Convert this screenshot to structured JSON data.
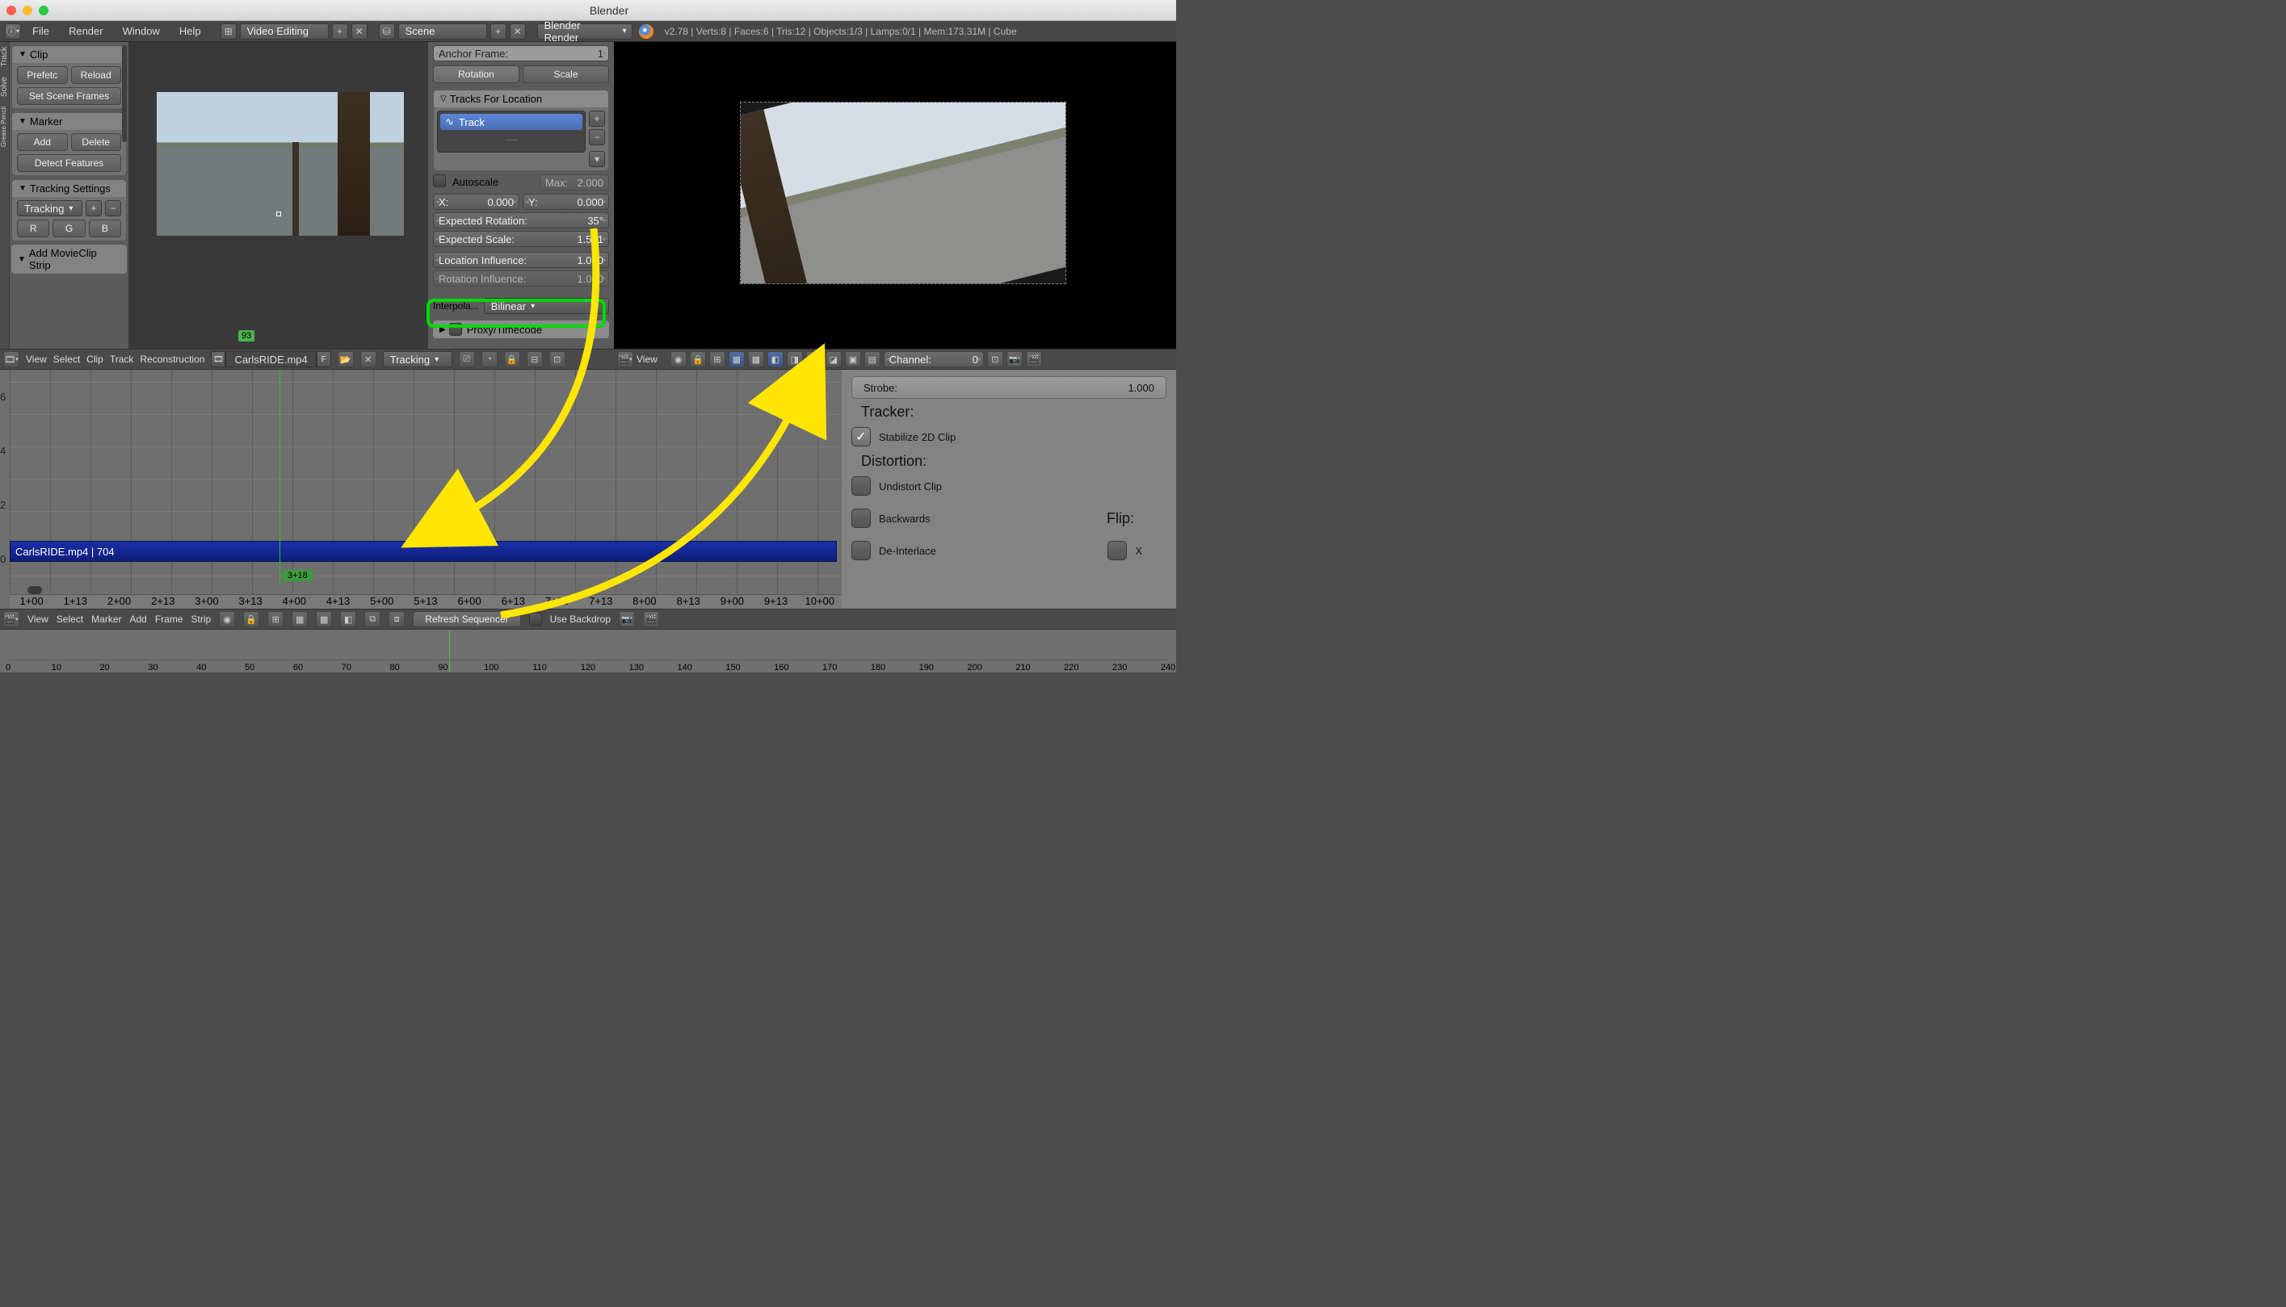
{
  "window": {
    "title": "Blender"
  },
  "topbar": {
    "menus": [
      "File",
      "Render",
      "Window",
      "Help"
    ],
    "screen_layout": "Video Editing",
    "scene": "Scene",
    "engine": "Blender Render",
    "stats": "v2.78 | Verts:8 | Faces:6 | Tris:12 | Objects:1/3 | Lamps:0/1 | Mem:173.31M | Cube"
  },
  "tool_tabs": [
    "Track",
    "Solve",
    "Grease Pencil"
  ],
  "tool_shelf": {
    "clip": {
      "title": "Clip",
      "prefetch": "Prefetc",
      "reload": "Reload",
      "set_scene_frames": "Set Scene Frames"
    },
    "marker": {
      "title": "Marker",
      "add": "Add",
      "delete": "Delete",
      "detect": "Detect Features"
    },
    "tracking_settings": {
      "title": "Tracking Settings",
      "preset": "Tracking",
      "channels": [
        "R",
        "G",
        "B"
      ]
    },
    "add_strip_title": "Add MovieClip Strip"
  },
  "props": {
    "anchor_frame_label": "Anchor Frame:",
    "anchor_frame_value": "1",
    "rotation_tab": "Rotation",
    "scale_tab": "Scale",
    "tracks_for_location": "Tracks For Location",
    "track_item": "Track",
    "autoscale_label": "Autoscale",
    "autoscale_max_label": "Max:",
    "autoscale_max_value": "2.000",
    "x_label": "X:",
    "x_value": "0.000",
    "y_label": "Y:",
    "y_value": "0.000",
    "exp_rot_label": "Expected Rotation:",
    "exp_rot_value": "35°",
    "exp_scale_label": "Expected Scale:",
    "exp_scale_value": "1.571",
    "loc_inf_label": "Location Influence:",
    "loc_inf_value": "1.000",
    "rot_inf_label": "Rotation Influence:",
    "rot_inf_value": "1.000",
    "interp_label": "Interpola...",
    "interp_value": "Bilinear",
    "proxy_label": "Proxy/Timecode"
  },
  "clip_header": {
    "menus": [
      "View",
      "Select",
      "Clip",
      "Track",
      "Reconstruction"
    ],
    "file": "CarlsRIDE.mp4",
    "mode": "Tracking",
    "f_btn": "F"
  },
  "vse_r_header": {
    "view": "View",
    "channel_label": "Channel:",
    "channel_value": "0"
  },
  "sequencer": {
    "strip_label": "CarlsRIDE.mp4 | 704",
    "frame_flag_top": "93",
    "playhead_label": "3+18",
    "y_ticks": [
      "0",
      "2",
      "4",
      "6"
    ],
    "ruler": [
      "1+00",
      "1+13",
      "2+00",
      "2+13",
      "3+00",
      "3+13",
      "4+00",
      "4+13",
      "5+00",
      "5+13",
      "6+00",
      "6+13",
      "7+00",
      "7+13",
      "8+00",
      "8+13",
      "9+00",
      "9+13",
      "10+00"
    ]
  },
  "vse_rt": {
    "strobe_label": "Strobe:",
    "strobe_value": "1.000",
    "tracker_label": "Tracker:",
    "stabilize_label": "Stabilize 2D Clip",
    "distortion_label": "Distortion:",
    "undistort_label": "Undistort Clip",
    "backwards_label": "Backwards",
    "flip_label": "Flip:",
    "deinterlace_label": "De-Interlace",
    "x_label": "X"
  },
  "vse_header": {
    "menus": [
      "View",
      "Select",
      "Marker",
      "Add",
      "Frame",
      "Strip"
    ],
    "refresh": "Refresh Sequencer",
    "backdrop": "Use Backdrop"
  },
  "timeline": {
    "ticks": [
      "0",
      "10",
      "20",
      "30",
      "40",
      "50",
      "60",
      "70",
      "80",
      "90",
      "100",
      "110",
      "120",
      "130",
      "140",
      "150",
      "160",
      "170",
      "180",
      "190",
      "200",
      "210",
      "220",
      "230",
      "240"
    ]
  }
}
